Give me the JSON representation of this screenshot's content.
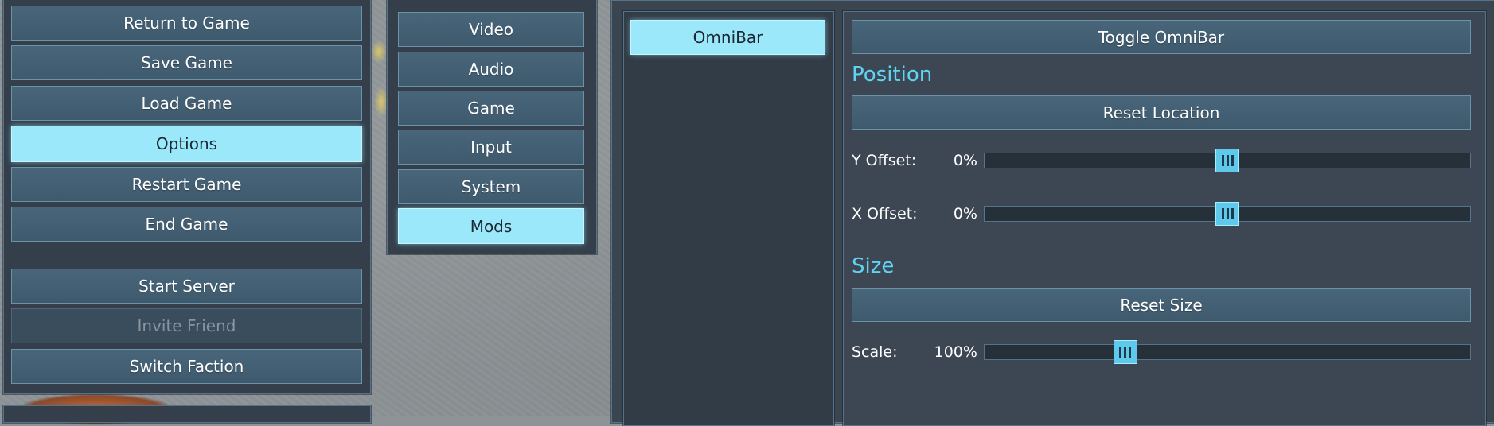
{
  "game_menu": {
    "items": [
      {
        "label": "Return to Game",
        "state": "normal"
      },
      {
        "label": "Save Game",
        "state": "normal"
      },
      {
        "label": "Load Game",
        "state": "normal"
      },
      {
        "label": "Options",
        "state": "active"
      },
      {
        "label": "Restart Game",
        "state": "normal"
      },
      {
        "label": "End Game",
        "state": "normal"
      }
    ],
    "secondary_items": [
      {
        "label": "Start Server",
        "state": "normal"
      },
      {
        "label": "Invite Friend",
        "state": "disabled"
      },
      {
        "label": "Switch Faction",
        "state": "normal"
      }
    ]
  },
  "options_tabs": [
    {
      "label": "Video",
      "state": "normal"
    },
    {
      "label": "Audio",
      "state": "normal"
    },
    {
      "label": "Game",
      "state": "normal"
    },
    {
      "label": "Input",
      "state": "normal"
    },
    {
      "label": "System",
      "state": "normal"
    },
    {
      "label": "Mods",
      "state": "active"
    }
  ],
  "mods_list": [
    {
      "label": "OmniBar",
      "state": "active"
    }
  ],
  "mod_settings": {
    "toggle_label": "Toggle OmniBar",
    "position": {
      "title": "Position",
      "reset_label": "Reset Location",
      "y_offset": {
        "label": "Y Offset:",
        "value_text": "0%",
        "value": 0.5
      },
      "x_offset": {
        "label": "X Offset:",
        "value_text": "0%",
        "value": 0.5
      }
    },
    "size": {
      "title": "Size",
      "reset_label": "Reset Size",
      "scale": {
        "label": "Scale:",
        "value_text": "100%",
        "value": 0.29
      }
    }
  },
  "colors": {
    "accent": "#9be8fb",
    "title": "#5fd3f1",
    "panel": "#343f4b",
    "button": "#466377"
  }
}
